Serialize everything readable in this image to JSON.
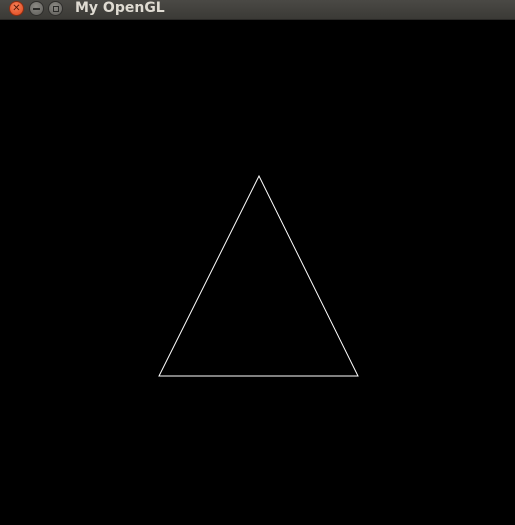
{
  "window": {
    "title": "My OpenGL",
    "controls": {
      "close_icon": "close-icon",
      "minimize_icon": "minimize-icon",
      "maximize_icon": "maximize-icon"
    }
  },
  "canvas": {
    "background_color": "#000000",
    "shape": "triangle",
    "stroke_color": "#ffffff",
    "fill": "none"
  }
}
